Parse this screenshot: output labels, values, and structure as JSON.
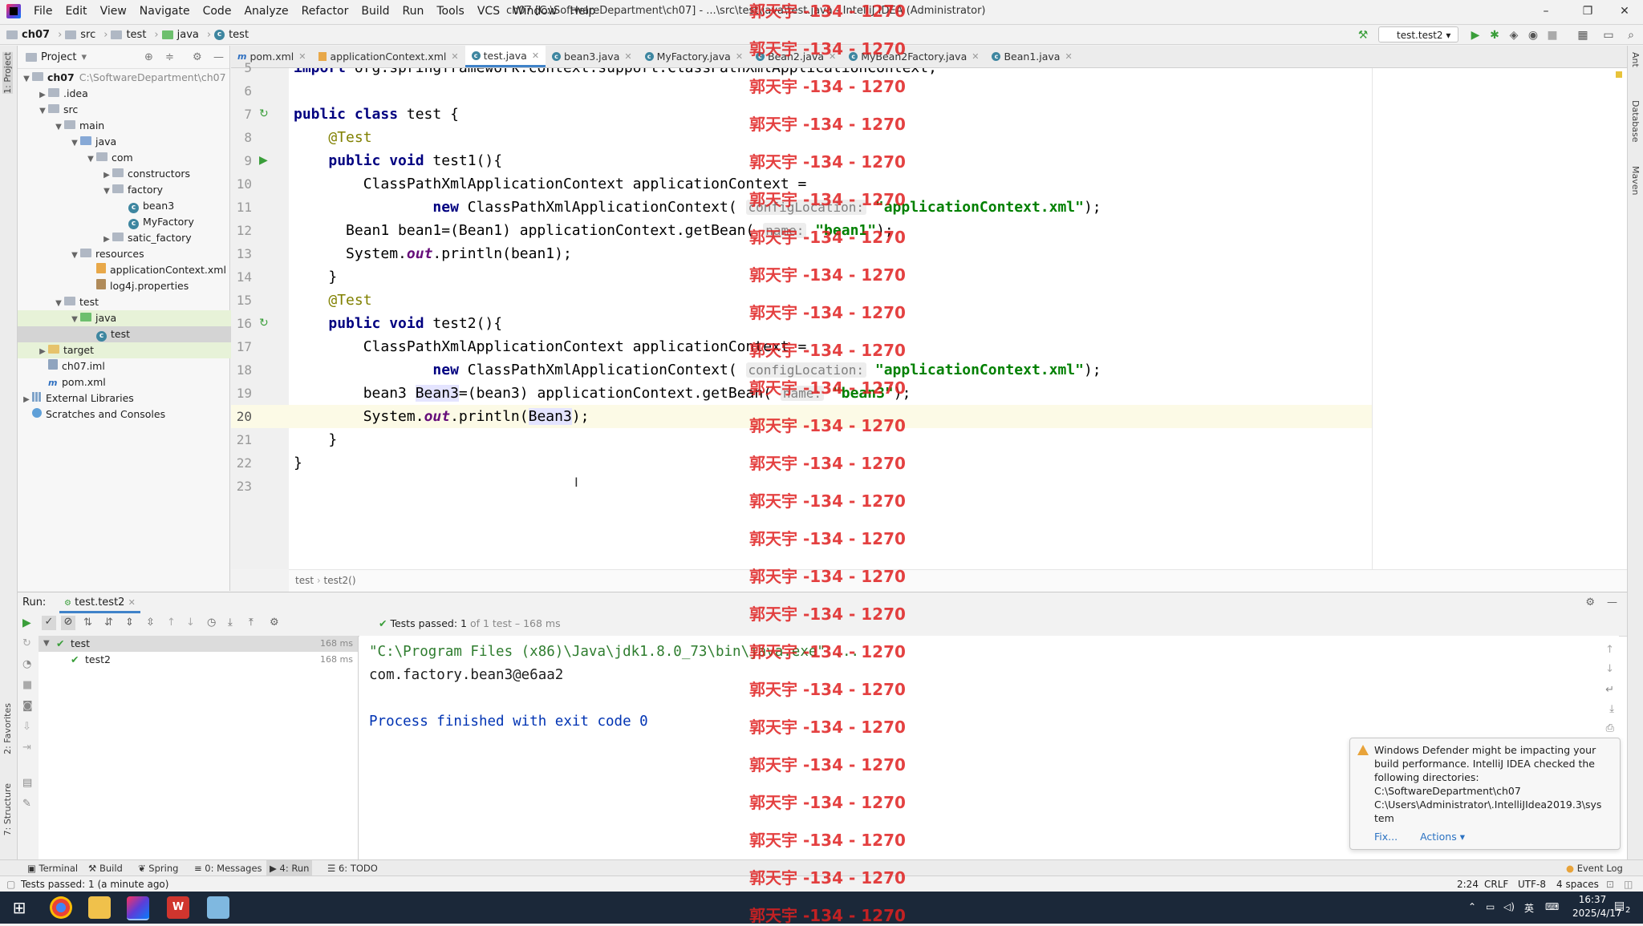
{
  "menubar": {
    "items": [
      "File",
      "Edit",
      "View",
      "Navigate",
      "Code",
      "Analyze",
      "Refactor",
      "Build",
      "Run",
      "Tools",
      "VCS",
      "Window",
      "Help"
    ],
    "window_title": "ch07 [C:\\SoftwareDepartment\\ch07] - ...\\src\\test\\java\\test.java - IntelliJ IDEA (Administrator)",
    "min": "–",
    "max": "❐",
    "close": "✕"
  },
  "navbar": {
    "crumbs": [
      "ch07",
      "src",
      "test",
      "java",
      "test"
    ],
    "run_config": "test.test2"
  },
  "project": {
    "title": "Project",
    "tree": [
      {
        "label": "ch07",
        "extra": "C:\\SoftwareDepartment\\ch07",
        "indent": 0,
        "arrow": "▼",
        "icon": "folder"
      },
      {
        "label": ".idea",
        "indent": 1,
        "arrow": "▶",
        "icon": "folder"
      },
      {
        "label": "src",
        "indent": 1,
        "arrow": "▼",
        "icon": "folder"
      },
      {
        "label": "main",
        "indent": 2,
        "arrow": "▼",
        "icon": "folder"
      },
      {
        "label": "java",
        "indent": 3,
        "arrow": "▼",
        "icon": "folder-blue"
      },
      {
        "label": "com",
        "indent": 4,
        "arrow": "▼",
        "icon": "folder"
      },
      {
        "label": "constructors",
        "indent": 5,
        "arrow": "▶",
        "icon": "folder"
      },
      {
        "label": "factory",
        "indent": 5,
        "arrow": "▼",
        "icon": "folder"
      },
      {
        "label": "bean3",
        "indent": 6,
        "arrow": "",
        "icon": "class"
      },
      {
        "label": "MyFactory",
        "indent": 6,
        "arrow": "",
        "icon": "class"
      },
      {
        "label": "satic_factory",
        "indent": 5,
        "arrow": "▶",
        "icon": "folder"
      },
      {
        "label": "resources",
        "indent": 3,
        "arrow": "▼",
        "icon": "folder"
      },
      {
        "label": "applicationContext.xml",
        "indent": 4,
        "arrow": "",
        "icon": "xml"
      },
      {
        "label": "log4j.properties",
        "indent": 4,
        "arrow": "",
        "icon": "prop"
      },
      {
        "label": "test",
        "indent": 2,
        "arrow": "▼",
        "icon": "folder"
      },
      {
        "label": "java",
        "indent": 3,
        "arrow": "▼",
        "icon": "folder-green",
        "state": "hl"
      },
      {
        "label": "test",
        "indent": 4,
        "arrow": "",
        "icon": "class",
        "state": "sel"
      },
      {
        "label": "target",
        "indent": 1,
        "arrow": "▶",
        "icon": "folder-yellow",
        "state": "hl2"
      },
      {
        "label": "ch07.iml",
        "indent": 1,
        "arrow": "",
        "icon": "iml"
      },
      {
        "label": "pom.xml",
        "indent": 1,
        "arrow": "",
        "icon": "m"
      },
      {
        "label": "External Libraries",
        "indent": 0,
        "arrow": "▶",
        "icon": "lib"
      },
      {
        "label": "Scratches and Consoles",
        "indent": 0,
        "arrow": "",
        "icon": "scr"
      }
    ]
  },
  "editor_tabs": [
    {
      "label": "pom.xml",
      "icon": "m"
    },
    {
      "label": "applicationContext.xml",
      "icon": "xml"
    },
    {
      "label": "test.java",
      "icon": "c",
      "active": true
    },
    {
      "label": "bean3.java",
      "icon": "c"
    },
    {
      "label": "MyFactory.java",
      "icon": "c"
    },
    {
      "label": "Bean2.java",
      "icon": "c"
    },
    {
      "label": "MyBean2Factory.java",
      "icon": "c"
    },
    {
      "label": "Bean1.java",
      "icon": "c"
    }
  ],
  "editor": {
    "current_line": 20,
    "breadcrumb": [
      "test",
      "test2()"
    ],
    "lines": [
      {
        "n": 5,
        "html": "<span class='kw'>import</span> org.springframework.context.support.ClassPathXmlApplicationContext;"
      },
      {
        "n": 6,
        "html": ""
      },
      {
        "n": 7,
        "html": "<span class='kw'>public class</span> test {",
        "run": "↻"
      },
      {
        "n": 8,
        "html": "    <span class='ann'>@Test</span>"
      },
      {
        "n": 9,
        "html": "    <span class='kw'>public void</span> test1(){",
        "run": "▶"
      },
      {
        "n": 10,
        "html": "        ClassPathXmlApplicationContext applicationContext ="
      },
      {
        "n": 11,
        "html": "                <span class='kw'>new</span> ClassPathXmlApplicationContext( <span class='hint'>configLocation:</span> <span class='str'>\"applicationContext.xml\"</span>);"
      },
      {
        "n": 12,
        "html": "      Bean1 bean1=(Bean1) applicationContext.getBean( <span class='hint'>name:</span> <span class='str'>\"bean1\"</span>);"
      },
      {
        "n": 13,
        "html": "      System.<span class='static'>out</span>.println(bean1);"
      },
      {
        "n": 14,
        "html": "    }"
      },
      {
        "n": 15,
        "html": "    <span class='ann'>@Test</span>"
      },
      {
        "n": 16,
        "html": "    <span class='kw'>public void</span> test2(){",
        "run": "↻"
      },
      {
        "n": 17,
        "html": "        ClassPathXmlApplicationContext applicationContext ="
      },
      {
        "n": 18,
        "html": "                <span class='kw'>new</span> ClassPathXmlApplicationContext( <span class='hint'>configLocation:</span> <span class='str'>\"applicationContext.xml\"</span>);"
      },
      {
        "n": 19,
        "html": "        bean3 <span class='varhl'>Bean3</span>=(bean3) applicationContext.getBean( <span class='hint'>name:</span> <span class='str'>\"bean3\"</span>);"
      },
      {
        "n": 20,
        "html": "        System.<span class='static'>out</span>.println(<span class='varhl'>Bean3</span>);"
      },
      {
        "n": 21,
        "html": "    }"
      },
      {
        "n": 22,
        "html": "}"
      },
      {
        "n": 23,
        "html": ""
      }
    ]
  },
  "run_panel": {
    "label": "Run:",
    "tab": "test.test2",
    "status_prefix": "Tests passed: 1",
    "status_suffix": "of 1 test – 168 ms",
    "tree": [
      {
        "label": "test",
        "time": "168 ms"
      },
      {
        "label": "test2",
        "time": "168 ms"
      }
    ],
    "console": [
      "\"C:\\Program Files (x86)\\Java\\jdk1.8.0_73\\bin\\java.exe\" ...",
      "com.factory.bean3@e6aa2",
      "",
      "Process finished with exit code 0"
    ]
  },
  "notification": {
    "text_lines": [
      "Windows Defender might be impacting your",
      "build performance. IntelliJ IDEA checked the",
      "following directories:",
      "C:\\SoftwareDepartment\\ch07",
      "C:\\Users\\Administrator\\.IntelliJIdea2019.3\\sys",
      "tem"
    ],
    "fix": "Fix...",
    "actions": "Actions ▾"
  },
  "bottom_tools": [
    "Terminal",
    "Build",
    "Spring",
    "0: Messages",
    "4: Run",
    "6: TODO"
  ],
  "event_log": "Event Log",
  "status_bar": {
    "message": "Tests passed: 1 (a minute ago)",
    "position": "2:24",
    "line_sep": "CRLF",
    "encoding": "UTF-8",
    "indent": "4 spaces"
  },
  "side_tabs": {
    "left": [
      "1: Project",
      "2: Favorites",
      "7: Structure"
    ],
    "right": [
      "Ant",
      "Database",
      "Maven"
    ]
  },
  "taskbar": {
    "time": "16:37",
    "date": "2025/4/17",
    "ime": "英",
    "notif_count": "2"
  },
  "watermark": "郭天宇 -134 - 1270"
}
